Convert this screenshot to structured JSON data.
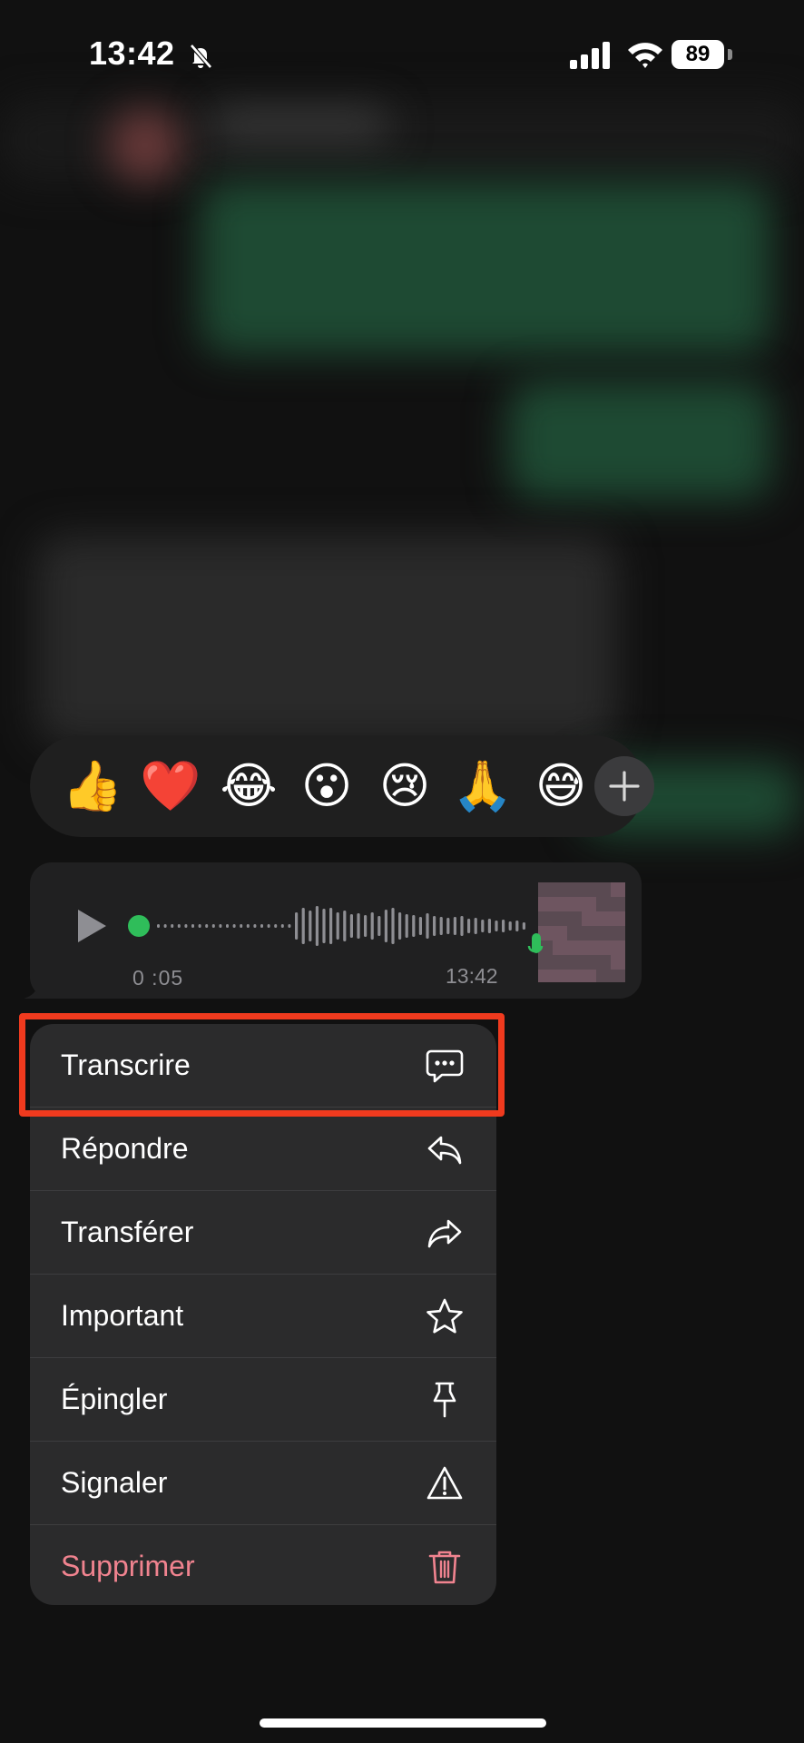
{
  "status_bar": {
    "time": "13:42",
    "battery": "89",
    "icons": [
      "bell-slash-icon",
      "signal-icon",
      "wifi-icon",
      "battery-icon"
    ]
  },
  "reactions": {
    "emojis": [
      {
        "name": "thumbs-up",
        "char": "👍"
      },
      {
        "name": "heart",
        "char": "❤️"
      },
      {
        "name": "tears-of-joy",
        "char": "😂"
      },
      {
        "name": "surprised",
        "char": "😮"
      },
      {
        "name": "crying",
        "char": "😢"
      },
      {
        "name": "folded-hands",
        "char": "🙏"
      },
      {
        "name": "grinning-sweat",
        "char": "😅"
      }
    ],
    "more_icon": "plus-icon"
  },
  "voice_message": {
    "duration": "0 :05",
    "time": "13:42"
  },
  "menu": {
    "items": [
      {
        "label": "Transcrire",
        "icon": "transcribe-bubble-icon"
      },
      {
        "label": "Répondre",
        "icon": "reply-icon"
      },
      {
        "label": "Transférer",
        "icon": "forward-icon"
      },
      {
        "label": "Important",
        "icon": "star-icon"
      },
      {
        "label": "Épingler",
        "icon": "pin-icon"
      },
      {
        "label": "Signaler",
        "icon": "warning-icon"
      },
      {
        "label": "Supprimer",
        "icon": "trash-icon"
      }
    ]
  },
  "colors": {
    "background": "#111111",
    "menu_bg": "#2b2b2c",
    "danger": "#f0838f",
    "highlight": "#f03a1e",
    "waveform_dot": "#2fbd5a"
  }
}
